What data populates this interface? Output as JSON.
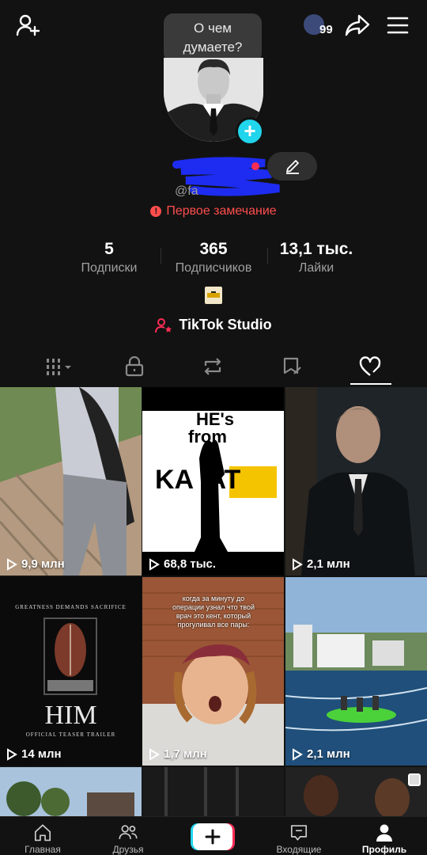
{
  "header": {
    "thought_bubble": "О чем думаете?",
    "notification_count": "99"
  },
  "profile": {
    "username": "@fa",
    "warning": "Первое замечание",
    "stats": [
      {
        "value": "5",
        "label": "Подписки"
      },
      {
        "value": "365",
        "label": "Подписчиков"
      },
      {
        "value": "13,1 тыс.",
        "label": "Лайки"
      }
    ],
    "studio_label": "TikTok Studio"
  },
  "tabs": [
    {
      "icon": "grid-icon"
    },
    {
      "icon": "lock-icon"
    },
    {
      "icon": "repost-icon"
    },
    {
      "icon": "favorites-icon"
    },
    {
      "icon": "liked-icon"
    }
  ],
  "videos": [
    {
      "views": "9,9 млн",
      "theme": "person-walking"
    },
    {
      "views": "68,8 тыс.",
      "theme": "hes-from",
      "title_line1": "HE's",
      "title_line2": "from",
      "title_line3": "KA  AT"
    },
    {
      "views": "2,1 млн",
      "theme": "portrait-suit"
    },
    {
      "views": "14 млн",
      "theme": "movie-poster",
      "top_text": "GREATNESS DEMANDS SACRIFICE",
      "title": "HIM",
      "subtitle": "OFFICIAL TEASER TRAILER"
    },
    {
      "views": "1,7 млн",
      "theme": "guy-face",
      "caption": "когда за минуту до операции узнал что твой врач это кент, который прогуливал все пары:"
    },
    {
      "views": "2,1 млн",
      "theme": "sea-tube"
    }
  ],
  "bottom_nav": [
    {
      "label": "Главная",
      "icon": "home-icon"
    },
    {
      "label": "Друзья",
      "icon": "friends-icon"
    },
    {
      "label": "",
      "icon": "create-icon"
    },
    {
      "label": "Входящие",
      "icon": "inbox-icon"
    },
    {
      "label": "Профиль",
      "icon": "profile-icon"
    }
  ],
  "colors": {
    "background": "#121212",
    "accent_cyan": "#20d5ec",
    "accent_red": "#fe2c55",
    "warning": "#ff4d4d"
  }
}
